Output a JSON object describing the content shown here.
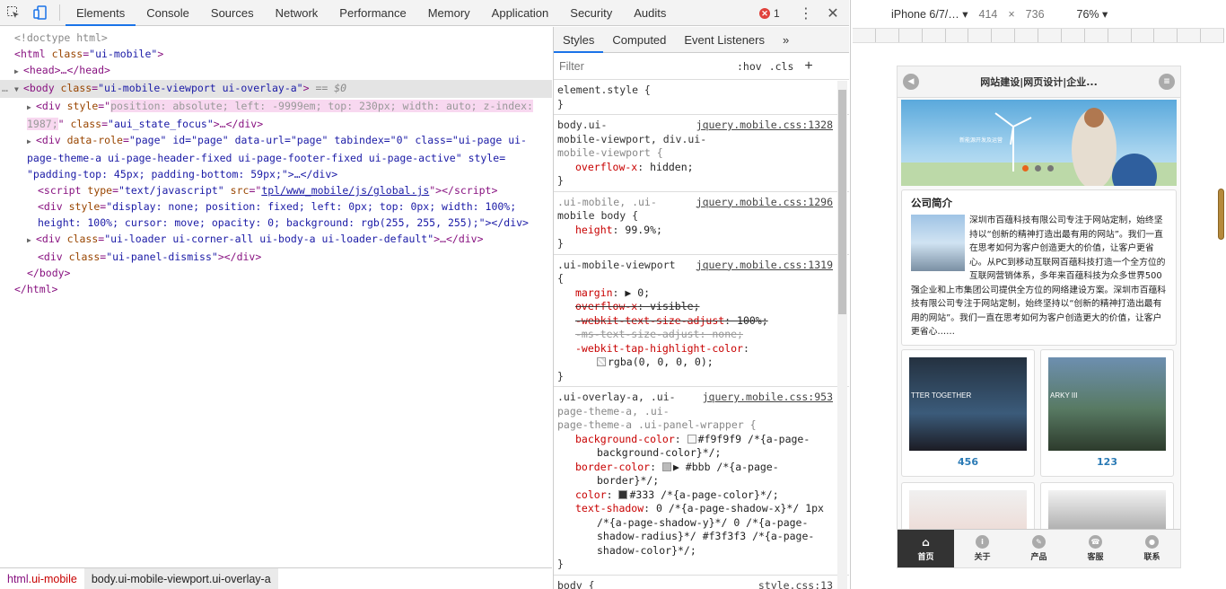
{
  "topbar": {
    "tabs": [
      "Elements",
      "Console",
      "Sources",
      "Network",
      "Performance",
      "Memory",
      "Application",
      "Security",
      "Audits"
    ],
    "active_tab": "Elements",
    "error_count": "1"
  },
  "tree": {
    "doctype": "<!doctype html>",
    "html_open_tag": "html",
    "html_attr": "class",
    "html_val": "\"ui-mobile\"",
    "head_text": "<head>…</head>",
    "body_attr_val": "\"ui-mobile-viewport ui-overlay-a\"",
    "body_eq": "== $0",
    "div1_style": "position: absolute; left: -9999em; top: 230px; width: auto; z-index:",
    "div1_style2": "1987;",
    "div1_class": "\"aui_state_focus\"",
    "div2_line1": "\"page\"  id=\"page\"  data-url=\"page\"  tabindex=\"0\"  class=\"ui-page ui-",
    "div2_line2": "page-theme-a ui-page-header-fixed ui-page-footer-fixed ui-page-active\" style=",
    "div2_line3": "\"padding-top: 45px; padding-bottom: 59px;\">…</div>",
    "script_src": "tpl/www_mobile/js/global.js",
    "div3_line1": "\"display: none; position: fixed; left: 0px; top: 0px; width: 100%;",
    "div3_line2": "height: 100%; cursor: move; opacity: 0; background: rgb(255, 255, 255);\"></div>",
    "loader_class": "\"ui-loader ui-corner-all ui-body-a ui-loader-default\"",
    "panel_class": "\"ui-panel-dismiss\"",
    "body_close": "</body>",
    "html_close": "</html>"
  },
  "breadcrumbs": {
    "crumb1_tag": "html",
    "crumb1_cls": ".ui-mobile",
    "crumb2": "body.ui-mobile-viewport.ui-overlay-a"
  },
  "styles": {
    "tabs": [
      "Styles",
      "Computed",
      "Event Listeners"
    ],
    "more": "»",
    "filter_placeholder": "Filter",
    "hov": ":hov",
    "cls": ".cls",
    "plus": "+",
    "rule0_sel": "element.style {",
    "rule1_sel_a": "body.ui-",
    "rule1_sel_b": "mobile-viewport, div.ui-",
    "rule1_sel_c": "mobile-viewport {",
    "rule1_src": "jquery.mobile.css:1328",
    "rule1_prop": "overflow-x",
    "rule1_val": "hidden;",
    "rule2_sel_a": ".ui-mobile, .ui-",
    "rule2_sel_b": "mobile body {",
    "rule2_src": "jquery.mobile.css:1296",
    "rule2_prop": "height",
    "rule2_val": "99.9%;",
    "rule3_sel": ".ui-mobile-viewport",
    "rule3_src": "jquery.mobile.css:1319",
    "rule3_props": [
      {
        "n": "margin",
        "v": "▶ 0;",
        "strike": false
      },
      {
        "n": "overflow-x",
        "v": "visible;",
        "strike": true
      },
      {
        "n": "-webkit-text-size-adjust",
        "v": "100%;",
        "strike": true
      },
      {
        "n": "-ms-text-size-adjust",
        "v": "none;",
        "strike": true
      },
      {
        "n": "-webkit-tap-highlight-color",
        "v": "",
        "strike": false
      }
    ],
    "rule3_last_val": "rgba(0, 0, 0, 0);",
    "rule4_sel_a": ".ui-overlay-a, .ui-",
    "rule4_sel_b": "page-theme-a, .ui-",
    "rule4_sel_c": "page-theme-a .ui-panel-wrapper {",
    "rule4_src": "jquery.mobile.css:953",
    "rule4_bg_prop": "background-color",
    "rule4_bg_val": "#f9f9f9 /*{a-page-",
    "rule4_bg_val2": "background-color}*/;",
    "rule4_border_prop": "border-color",
    "rule4_border_val": "▶ #bbb /*{a-page-",
    "rule4_border_val2": "border}*/;",
    "rule4_color_prop": "color",
    "rule4_color_val": "#333 /*{a-page-color}*/;",
    "rule4_ts_prop": "text-shadow",
    "rule4_ts_val": "0 /*{a-page-shadow-x}*/ 1px",
    "rule4_ts_val2": "/*{a-page-shadow-y}*/ 0 /*{a-page-",
    "rule4_ts_val3": "shadow-radius}*/ #f3f3f3 /*{a-page-",
    "rule4_ts_val4": "shadow-color}*/;",
    "rule5_sel": "body {",
    "rule5_src": "style.css:13",
    "colors": {
      "swatch_f9": "#f9f9f9",
      "swatch_bbb": "#bbbbbb",
      "swatch_333": "#333333"
    }
  },
  "device": {
    "name": "iPhone 6/7/…",
    "width": "414",
    "times": "×",
    "height": "736",
    "zoom": "76%"
  },
  "mobile": {
    "header_title": "网站建设|网页设计|企业...",
    "banner_text": "新能源开发及运营",
    "about_title": "公司简介",
    "about_text": "深圳市百蕴科技有限公司专注于网站定制，始终坚持以“创新的精神打造出最有用的网站”。我们一直在思考如何为客户创造更大的价值，让客户更省心。从PC到移动互联网百蕴科技打造一个全方位的互联网营销体系，多年来百蕴科技为众多世界500强企业和上市集团公司提供全方位的网络建设方案。深圳市百蕴科技有限公司专注于网站定制，始终坚持以“创新的精神打造出最有用的网站”。我们一直在思考如何为客户创造更大的价值，让客户更省心……",
    "card1_label": "456",
    "card2_label": "123",
    "card1_caption": "TTER TOGETHER",
    "card2_caption": "ARKY III",
    "nav": [
      "首页",
      "关于",
      "产品",
      "客服",
      "联系"
    ]
  }
}
